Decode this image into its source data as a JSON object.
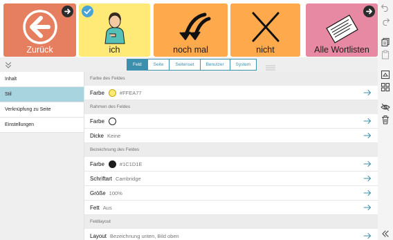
{
  "tiles": {
    "back": {
      "label": "Zurück",
      "color": "#E67F5F"
    },
    "ich": {
      "label": "ich",
      "color": "#FFEA77"
    },
    "noch_mal": {
      "label": "noch mal",
      "color": "#FFA94D"
    },
    "nicht": {
      "label": "nicht",
      "color": "#FFA94D"
    },
    "alle": {
      "label": "Alle Wortlisten",
      "color": "#E889A3"
    }
  },
  "toolbar_icons": [
    "undo-icon",
    "redo-icon",
    "copy-icon",
    "paste-icon",
    "crop-icon",
    "grid-icon",
    "hide-icon",
    "trash-icon",
    "collapse-left-icon"
  ],
  "tabs": [
    "Feld",
    "Seite",
    "Seitenset",
    "Benutzer",
    "System"
  ],
  "active_tab": "Feld",
  "nav": [
    "Inhalt",
    "Stil",
    "Verknüpfung zu Seite",
    "Einstellungen"
  ],
  "active_nav": "Stil",
  "sections": {
    "feld": {
      "title": "Farbe des Feldes",
      "farbe": {
        "label": "Farbe",
        "value": "#FFEA77",
        "swatch": "#FFEA77"
      }
    },
    "rahmen": {
      "title": "Rahmen des Feldes",
      "farbe": {
        "label": "Farbe",
        "swatch": "#FFFFFF"
      },
      "dicke": {
        "label": "Dicke",
        "value": "Keine"
      }
    },
    "bezeichnung": {
      "title": "Bezeichnung des Feldes",
      "farbe": {
        "label": "Farbe",
        "value": "#1C1D1E",
        "swatch": "#1C1D1E"
      },
      "schriftart": {
        "label": "Schriftart",
        "value": "Cambridge"
      },
      "groesse": {
        "label": "Größe",
        "value": "100%"
      },
      "fett": {
        "label": "Fett",
        "value": "Aus"
      }
    },
    "layout": {
      "title": "Feldlayout",
      "layout": {
        "label": "Layout",
        "value": "Bezeichnung unten, Bild oben"
      }
    }
  },
  "colors": {
    "accent": "#3D8FAE",
    "active_nav": "#A8D4E0",
    "arrow": "#3D8FAE"
  }
}
